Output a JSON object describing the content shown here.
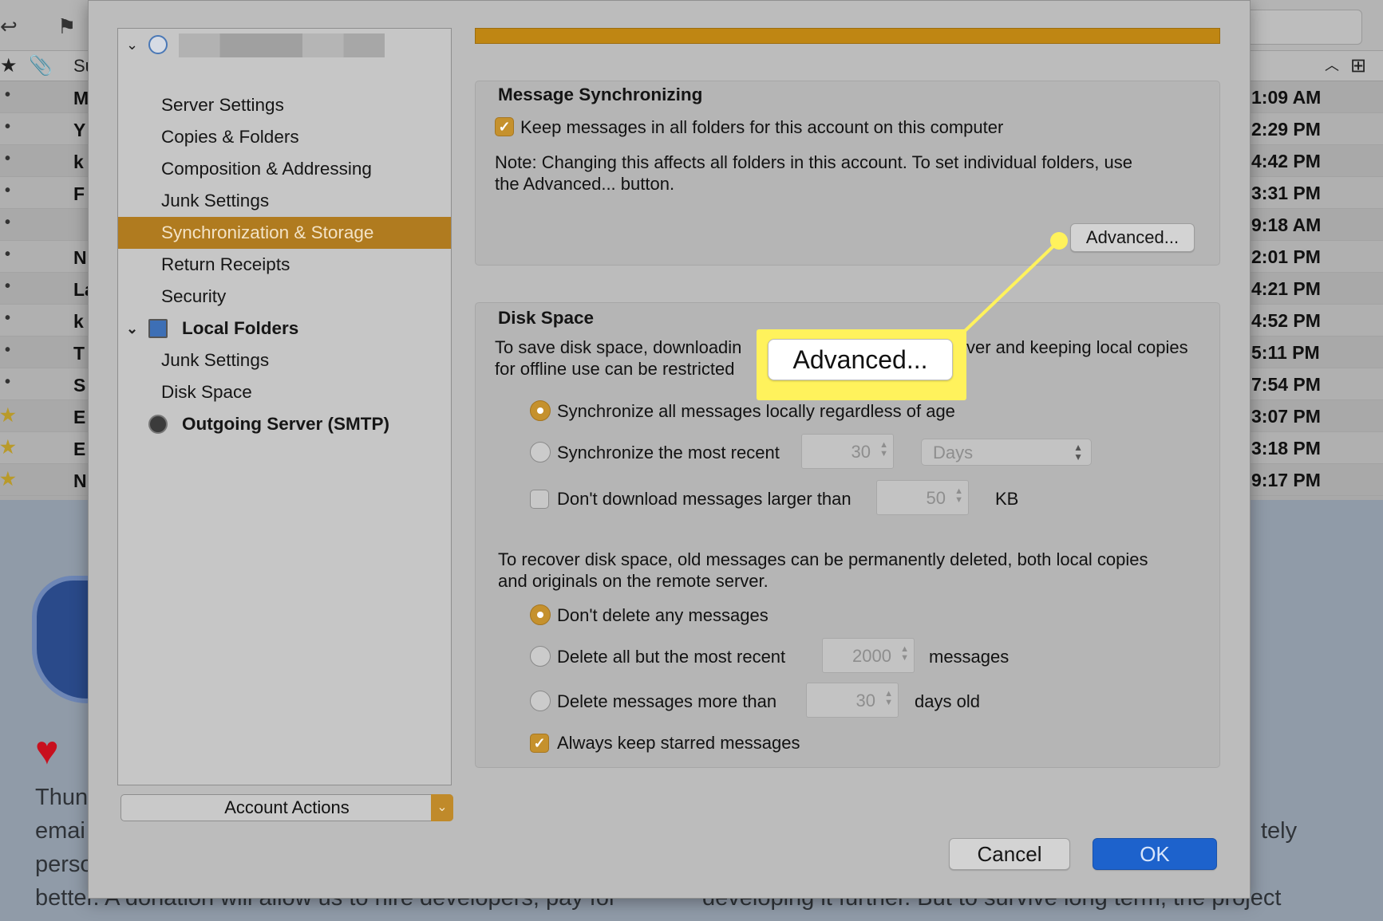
{
  "background": {
    "header_column": "Su",
    "rows": [
      {
        "subject": "M",
        "time": "1:09 AM",
        "marker": "dot"
      },
      {
        "subject": "Y",
        "time": "2:29 PM",
        "marker": "dot"
      },
      {
        "subject": "k",
        "time": "4:42 PM",
        "marker": "dot"
      },
      {
        "subject": "F",
        "time": "3:31 PM",
        "marker": "dot"
      },
      {
        "subject": "",
        "time": "9:18 AM",
        "marker": "dot"
      },
      {
        "subject": "N",
        "time": "2:01 PM",
        "marker": "dot"
      },
      {
        "subject": "La",
        "time": "4:21 PM",
        "marker": "dot"
      },
      {
        "subject": "k",
        "time": "4:52 PM",
        "marker": "dot"
      },
      {
        "subject": "T",
        "time": "5:11 PM",
        "marker": "dot"
      },
      {
        "subject": "S",
        "time": "7:54 PM",
        "marker": "dot"
      },
      {
        "subject": "E",
        "time": "3:07 PM",
        "marker": "star"
      },
      {
        "subject": "E",
        "time": "3:18 PM",
        "marker": "star"
      },
      {
        "subject": "N",
        "time": "9:17 PM",
        "marker": "star"
      }
    ],
    "text_left": [
      "Thun",
      "emai",
      "perso",
      "bette"
    ],
    "text_right_top": "tely",
    "text_bottom": "better. A donation will allow us to hire developers, pay for",
    "text_bottom_right": "developing it further. But to survive long term, the project"
  },
  "sidebar": {
    "account_name": "",
    "items": [
      {
        "label": "Server Settings"
      },
      {
        "label": "Copies & Folders"
      },
      {
        "label": "Composition & Addressing"
      },
      {
        "label": "Junk Settings"
      },
      {
        "label": "Synchronization & Storage",
        "selected": true
      },
      {
        "label": "Return Receipts"
      },
      {
        "label": "Security"
      }
    ],
    "local_folders": {
      "label": "Local Folders",
      "items": [
        {
          "label": "Junk Settings"
        },
        {
          "label": "Disk Space"
        }
      ]
    },
    "outgoing": "Outgoing Server (SMTP)",
    "account_actions": "Account Actions"
  },
  "message_sync": {
    "title": "Message Synchronizing",
    "keep_label": "Keep messages in all folders for this account on this computer",
    "keep_checked": true,
    "note_line1": "Note: Changing this affects all folders in this account. To set individual folders, use",
    "note_line2": "the Advanced... button.",
    "advanced_button": "Advanced..."
  },
  "disk_space": {
    "title": "Disk Space",
    "intro_line1_a": "To save disk space, downloadin",
    "intro_line1_b": "ver and keeping local copies",
    "intro_line2": "for offline use can be restricted",
    "sync_all_label": "Synchronize all messages locally regardless of age",
    "sync_recent_label": "Synchronize the most recent",
    "sync_recent_value": "30",
    "sync_recent_unit": "Days",
    "dont_download_label": "Don't download messages larger than",
    "dont_download_value": "50",
    "dont_download_unit": "KB",
    "recover_line1": "To recover disk space, old messages can be permanently deleted, both local copies",
    "recover_line2": "and originals on the remote server.",
    "dont_delete_label": "Don't delete any messages",
    "delete_but_label": "Delete all but the most recent",
    "delete_but_value": "2000",
    "delete_but_unit": "messages",
    "delete_older_label": "Delete messages more than",
    "delete_older_value": "30",
    "delete_older_unit": "days old",
    "keep_starred_label": "Always keep starred messages",
    "keep_starred_checked": true,
    "sync_selected": "all",
    "delete_selected": "none"
  },
  "callout": {
    "label": "Advanced...",
    "highlight_color": "#fff25c"
  },
  "footer": {
    "cancel": "Cancel",
    "ok": "OK"
  },
  "colors": {
    "accent": "#b07b1f",
    "primary_button": "#1d62cc",
    "progress": "#bf8613"
  }
}
